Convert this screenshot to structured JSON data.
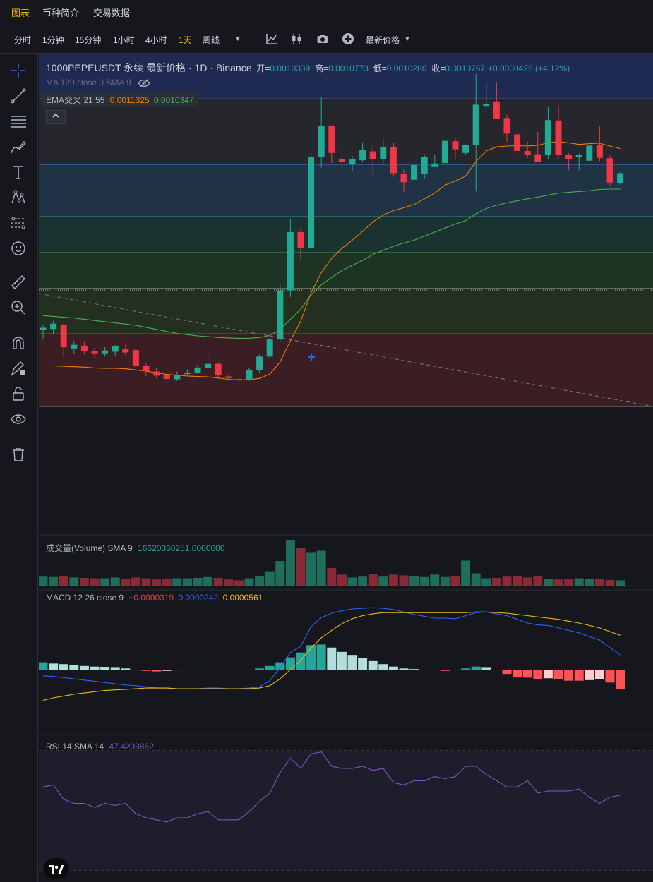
{
  "nav": {
    "tabs": [
      "图表",
      "币种简介",
      "交易数据"
    ]
  },
  "toolbar": {
    "timeframes": [
      "分时",
      "1分钟",
      "15分钟",
      "1小时",
      "4小时",
      "1天",
      "周线"
    ],
    "price_type": "最新价格",
    "icons": [
      "indicator-icon",
      "candle-type-icon",
      "camera-icon",
      "add-icon"
    ]
  },
  "sidebar": {
    "tools": [
      "crosshair-icon",
      "trendline-icon",
      "fib-lines-icon",
      "brush-icon",
      "text-icon",
      "pattern-icon",
      "forecast-icon",
      "emoji-icon",
      "ruler-icon",
      "zoom-in-icon",
      "magnet-icon",
      "lock-drawing-icon",
      "unlock-icon",
      "eye-icon",
      "trash-icon"
    ]
  },
  "legend": {
    "symbol": "1000PEPEUSDT 永续 最新价格 · 1D · Binance",
    "open_label": "开=",
    "open": "0.0010339",
    "high_label": "高=",
    "high": "0.0010773",
    "low_label": "低=",
    "low": "0.0010280",
    "close_label": "收=",
    "close": "0.0010767",
    "change": "+0.0000426 (+4.12%)",
    "ma": "MA 120 close 0 SMA 9",
    "ema_label": "EMA交叉 21 55",
    "ema1": "0.0011325",
    "ema2": "0.0010347",
    "volume_label": "成交量(Volume) SMA 9",
    "volume_value": "16620360251.0000000",
    "macd_label": "MACD 12 26 close 9",
    "macd_hist": "−0.0000319",
    "macd_line": "0.0000242",
    "macd_signal": "0.0000561",
    "rsi_label": "RSI 14 SMA 14",
    "rsi_value": "47.4203862"
  },
  "colors": {
    "up": "#22ab94",
    "down": "#f23645",
    "ema_fast": "#f57c00",
    "ema_slow": "#4caf50",
    "macd_line": "#2962ff",
    "macd_signal": "#f0b90b",
    "rsi": "#7e57c2",
    "accent": "#f0b90b"
  },
  "chart_data": {
    "type": "candlestick",
    "symbol": "1000PEPEUSDT",
    "interval": "1D",
    "ohlc": [
      [
        0.000618,
        0.000632,
        0.000596,
        0.000624
      ],
      [
        0.000621,
        0.000641,
        0.000609,
        0.000634
      ],
      [
        0.000632,
        0.000635,
        0.000551,
        0.000576
      ],
      [
        0.000573,
        0.000592,
        0.00056,
        0.000582
      ],
      [
        0.00058,
        0.000591,
        0.000559,
        0.000566
      ],
      [
        0.000566,
        0.000575,
        0.000549,
        0.000561
      ],
      [
        0.000561,
        0.000576,
        0.000553,
        0.000568
      ],
      [
        0.000565,
        0.000581,
        0.000555,
        0.000579
      ],
      [
        0.000571,
        0.000586,
        0.000556,
        0.000563
      ],
      [
        0.000569,
        0.000576,
        0.000518,
        0.00053
      ],
      [
        0.00053,
        0.000536,
        0.000505,
        0.000517
      ],
      [
        0.000516,
        0.000524,
        0.0005,
        0.000506
      ],
      [
        0.000507,
        0.00051,
        0.000494,
        0.000498
      ],
      [
        0.000497,
        0.000516,
        0.000493,
        0.000508
      ],
      [
        0.00051,
        0.000521,
        0.000507,
        0.000513
      ],
      [
        0.000513,
        0.000533,
        0.00051,
        0.000526
      ],
      [
        0.000525,
        0.000558,
        0.00052,
        0.000535
      ],
      [
        0.000535,
        0.000539,
        0.0005,
        0.000507
      ],
      [
        0.000504,
        0.000508,
        0.000498,
        0.0005
      ],
      [
        0.000498,
        0.000504,
        0.00049,
        0.000495
      ],
      [
        0.000496,
        0.000524,
        0.000493,
        0.000519
      ],
      [
        0.00052,
        0.000558,
        0.000513,
        0.000553
      ],
      [
        0.000553,
        0.0006,
        0.000548,
        0.000595
      ],
      [
        0.000595,
        0.00073,
        0.00059,
        0.000716
      ],
      [
        0.000716,
        0.000892,
        0.0007,
        0.00086
      ],
      [
        0.00086,
        0.00087,
        0.00079,
        0.00082
      ],
      [
        0.00082,
        0.001059,
        0.000818,
        0.001045
      ],
      [
        0.001045,
        0.001192,
        0.001019,
        0.001122
      ],
      [
        0.001122,
        0.001119,
        0.00103,
        0.001055
      ],
      [
        0.00104,
        0.001066,
        0.000993,
        0.001032
      ],
      [
        0.001028,
        0.001048,
        0.001011,
        0.00104
      ],
      [
        0.001037,
        0.00108,
        0.001032,
        0.001062
      ],
      [
        0.001059,
        0.001076,
        0.001002,
        0.001039
      ],
      [
        0.001039,
        0.00109,
        0.001027,
        0.00107
      ],
      [
        0.00107,
        0.00108,
        0.000996,
        0.001005
      ],
      [
        0.001003,
        0.001015,
        0.000958,
        0.000983
      ],
      [
        0.000989,
        0.001036,
        0.000983,
        0.001025
      ],
      [
        0.001004,
        0.001052,
        0.000991,
        0.001046
      ],
      [
        0.001022,
        0.00105,
        0.001025,
        0.001029
      ],
      [
        0.00103,
        0.00109,
        0.001032,
        0.001085
      ],
      [
        0.001084,
        0.001093,
        0.00104,
        0.001064
      ],
      [
        0.001055,
        0.001076,
        0.00105,
        0.001074
      ],
      [
        0.001075,
        0.00125,
        0.00096,
        0.001174
      ],
      [
        0.001171,
        0.001229,
        0.001167,
        0.001175
      ],
      [
        0.001182,
        0.00123,
        0.00114,
        0.00114
      ],
      [
        0.001141,
        0.00115,
        0.001082,
        0.001103
      ],
      [
        0.001101,
        0.001114,
        0.001045,
        0.00106
      ],
      [
        0.00106,
        0.001083,
        0.001043,
        0.00105
      ],
      [
        0.001052,
        0.001107,
        0.001035,
        0.001033
      ],
      [
        0.00105,
        0.00117,
        0.00104,
        0.001136
      ],
      [
        0.001135,
        0.001172,
        0.00104,
        0.00105
      ],
      [
        0.00105,
        0.001055,
        0.001013,
        0.00104
      ],
      [
        0.001044,
        0.001054,
        0.001012,
        0.00105
      ],
      [
        0.001036,
        0.001075,
        0.001034,
        0.001073
      ],
      [
        0.001074,
        0.00112,
        0.001035,
        0.001043
      ],
      [
        0.001042,
        0.00105,
        0.000975,
        0.000982
      ],
      [
        0.000981,
        0.001007,
        0.000977,
        0.001005
      ]
    ],
    "ema_fast": [
      0.00053,
      0.00053,
      0.000529,
      0.000528,
      0.000527,
      0.000525,
      0.000524,
      0.000524,
      0.000523,
      0.00052,
      0.000517,
      0.000513,
      0.000509,
      0.000507,
      0.000505,
      0.000504,
      0.000503,
      0.0005,
      0.000497,
      0.000495,
      0.000496,
      0.000499,
      0.00051,
      0.00054,
      0.000592,
      0.00064,
      0.00071,
      0.00076,
      0.000795,
      0.00082,
      0.00084,
      0.000862,
      0.000885,
      0.000902,
      0.000913,
      0.00092,
      0.000928,
      0.000942,
      0.000956,
      0.000976,
      0.000986,
      0.000998,
      0.001034,
      0.00106,
      0.00107,
      0.001072,
      0.001073,
      0.001072,
      0.001074,
      0.00108,
      0.001083,
      0.00108,
      0.001076,
      0.001078,
      0.001079,
      0.001072,
      0.001066
    ],
    "ema_slow": [
      0.000654,
      0.000652,
      0.00065,
      0.000648,
      0.000645,
      0.000642,
      0.000639,
      0.000636,
      0.000633,
      0.00063,
      0.000625,
      0.00062,
      0.000615,
      0.00061,
      0.000607,
      0.000604,
      0.000602,
      0.0006,
      0.000599,
      0.000598,
      0.000598,
      0.0006,
      0.000605,
      0.00062,
      0.000645,
      0.00067,
      0.000705,
      0.00073,
      0.000748,
      0.000765,
      0.000778,
      0.00079,
      0.000805,
      0.000815,
      0.000825,
      0.000833,
      0.00084,
      0.00085,
      0.00086,
      0.00087,
      0.00088,
      0.000888,
      0.000905,
      0.000918,
      0.000926,
      0.000932,
      0.000937,
      0.000942,
      0.000946,
      0.000951,
      0.000956,
      0.000958,
      0.00096,
      0.000962,
      0.000965,
      0.000966,
      0.000966
    ],
    "volume": [
      2.2,
      2.1,
      2.4,
      2.0,
      1.9,
      1.8,
      1.8,
      2.0,
      1.7,
      2.0,
      1.8,
      1.5,
      1.6,
      1.8,
      1.8,
      1.9,
      2.1,
      1.9,
      1.5,
      1.3,
      1.8,
      2.3,
      3.5,
      6.0,
      11.0,
      9.2,
      8.0,
      8.5,
      4.3,
      2.7,
      2.0,
      2.2,
      2.8,
      2.2,
      2.7,
      2.5,
      2.3,
      2.1,
      2.7,
      2.1,
      2.4,
      6.1,
      3.0,
      1.8,
      1.9,
      2.2,
      2.4,
      2.0,
      2.3,
      1.7,
      1.5,
      1.6,
      1.8,
      1.7,
      1.6,
      1.4,
      1.3
    ],
    "macd_hist": [
      1.2e-05,
      1e-05,
      9e-06,
      7e-06,
      6e-06,
      5e-06,
      4e-06,
      3e-06,
      2e-06,
      0.0,
      -2e-06,
      -3e-06,
      -2e-06,
      -1e-06,
      -1e-06,
      0.0,
      0.0,
      -1e-06,
      -1e-06,
      -1e-06,
      0.0,
      2e-06,
      6e-06,
      1.2e-05,
      2e-05,
      2.8e-05,
      4e-05,
      4.1e-05,
      3.6e-05,
      2.9e-05,
      2.4e-05,
      1.9e-05,
      1.4e-05,
      9e-06,
      5e-06,
      2e-06,
      1e-06,
      -1e-06,
      -1e-06,
      -2e-06,
      0.0,
      2e-06,
      5e-06,
      3e-06,
      -1e-06,
      -7e-06,
      -1.2e-05,
      -1.3e-05,
      -1.6e-05,
      -1.4e-05,
      -1.5e-05,
      -1.8e-05,
      -1.8e-05,
      -1.7e-05,
      -1.6e-05,
      -2.1e-05,
      -3.2e-05
    ],
    "macd_line": [
      -1e-05,
      -1.1e-05,
      -1.3e-05,
      -1.5e-05,
      -1.7e-05,
      -1.9e-05,
      -2.1e-05,
      -2.3e-05,
      -2.5e-05,
      -2.6e-05,
      -2.8e-05,
      -3e-05,
      -3e-05,
      -3.1e-05,
      -3.1e-05,
      -3.1e-05,
      -3e-05,
      -3e-05,
      -3.1e-05,
      -3.1e-05,
      -3e-05,
      -2.8e-05,
      -1.8e-05,
      3e-06,
      2.8e-05,
      3.8e-05,
      7e-05,
      8.5e-05,
      9.2e-05,
      9.6e-05,
      9.9e-05,
      0.0001,
      0.000101,
      0.0001,
      9.8e-05,
      9.4e-05,
      9e-05,
      8.7e-05,
      8.4e-05,
      8.4e-05,
      8.3e-05,
      8.8e-05,
      9.3e-05,
      9.4e-05,
      9.1e-05,
      8.8e-05,
      8.2e-05,
      7.6e-05,
      7.3e-05,
      7.2e-05,
      6.8e-05,
      6.4e-05,
      6e-05,
      5.4e-05,
      4.8e-05,
      3.6e-05,
      2.4e-05
    ],
    "macd_signal": [
      -5e-05,
      -4.6e-05,
      -4.3e-05,
      -4e-05,
      -3.8e-05,
      -3.6e-05,
      -3.4e-05,
      -3.3e-05,
      -3.2e-05,
      -3.1e-05,
      -3e-05,
      -3e-05,
      -3e-05,
      -3.1e-05,
      -3.1e-05,
      -3.1e-05,
      -3.1e-05,
      -3.1e-05,
      -3.1e-05,
      -3.1e-05,
      -3.1e-05,
      -3e-05,
      -2.6e-05,
      -1.5e-05,
      0.0,
      1.5e-05,
      3.5e-05,
      5.2e-05,
      6.4e-05,
      7.5e-05,
      8.3e-05,
      8.8e-05,
      9.1e-05,
      9.3e-05,
      9.3e-05,
      9.3e-05,
      9.3e-05,
      9.3e-05,
      9.3e-05,
      9.3e-05,
      9.3e-05,
      9.3e-05,
      9.4e-05,
      9.4e-05,
      9.3e-05,
      9.2e-05,
      9e-05,
      8.8e-05,
      8.6e-05,
      8.4e-05,
      8.2e-05,
      7.9e-05,
      7.6e-05,
      7.2e-05,
      6.8e-05,
      6.2e-05,
      5.6e-05
    ],
    "rsi": [
      58,
      59,
      52,
      50,
      50,
      48,
      50,
      49,
      50,
      45,
      43,
      42,
      41,
      43,
      43,
      45,
      46,
      42,
      42,
      42,
      46,
      51,
      55,
      65,
      72,
      67,
      74,
      75,
      68,
      67,
      67,
      68,
      66,
      67,
      60,
      59,
      61,
      61,
      63,
      62,
      63,
      68,
      68,
      64,
      61,
      58,
      58,
      61,
      55,
      56,
      56,
      56,
      57,
      53,
      50,
      53,
      54
    ],
    "price_ylim": [
      0.00043,
      0.0013
    ],
    "volume_ylim": [
      0,
      11
    ],
    "macd_ylim": [
      -0.0001,
      0.00013
    ],
    "rsi_ylim": [
      20,
      80
    ]
  }
}
